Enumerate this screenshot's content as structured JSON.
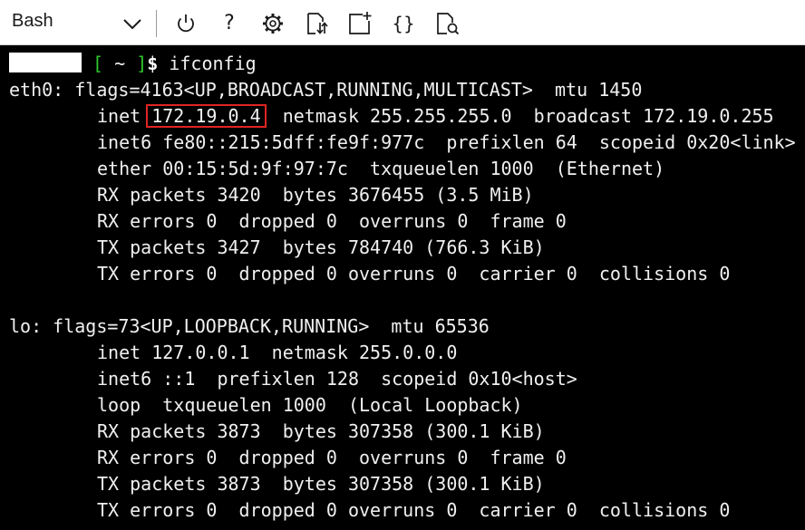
{
  "toolbar": {
    "shell_label": "Bash",
    "icons": [
      "chevron-down-icon",
      "power-icon",
      "help-icon",
      "settings-gear-icon",
      "upload-download-icon",
      "new-session-icon",
      "braces-icon",
      "open-editor-icon"
    ],
    "help_glyph": "?",
    "braces_glyph": "{}"
  },
  "terminal": {
    "prompt": {
      "bracket_open": "[",
      "path": " ~ ",
      "bracket_close": "]",
      "symbol": "$",
      "command": " ifconfig"
    },
    "eth0": {
      "flags": "eth0: flags=4163<UP,BROADCAST,RUNNING,MULTICAST>  mtu 1450",
      "inet_label": "inet ",
      "inet_ip": "172.19.0.4",
      "inet_rest": "  netmask 255.255.255.0  broadcast 172.19.0.255",
      "inet6": "inet6 fe80::215:5dff:fe9f:977c  prefixlen 64  scopeid 0x20<link>",
      "ether": "ether 00:15:5d:9f:97:7c  txqueuelen 1000  (Ethernet)",
      "rx_packets": "RX packets 3420  bytes 3676455 (3.5 MiB)",
      "rx_errors": "RX errors 0  dropped 0  overruns 0  frame 0",
      "tx_packets": "TX packets 3427  bytes 784740 (766.3 KiB)",
      "tx_errors": "TX errors 0  dropped 0 overruns 0  carrier 0  collisions 0"
    },
    "lo": {
      "flags": "lo: flags=73<UP,LOOPBACK,RUNNING>  mtu 65536",
      "inet": "inet 127.0.0.1  netmask 255.0.0.0",
      "inet6": "inet6 ::1  prefixlen 128  scopeid 0x10<host>",
      "loop": "loop  txqueuelen 1000  (Local Loopback)",
      "rx_packets": "RX packets 3873  bytes 307358 (300.1 KiB)",
      "rx_errors": "RX errors 0  dropped 0  overruns 0  frame 0",
      "tx_packets": "TX packets 3873  bytes 307358 (300.1 KiB)",
      "tx_errors": "TX errors 0  dropped 0 overruns 0  carrier 0  collisions 0"
    }
  },
  "colors": {
    "terminal_bg": "#000000",
    "terminal_text": "#f0f0f0",
    "prompt_bracket": "#2ec82e",
    "highlight_box": "#e02424",
    "toolbar_bg": "#ffffff"
  }
}
